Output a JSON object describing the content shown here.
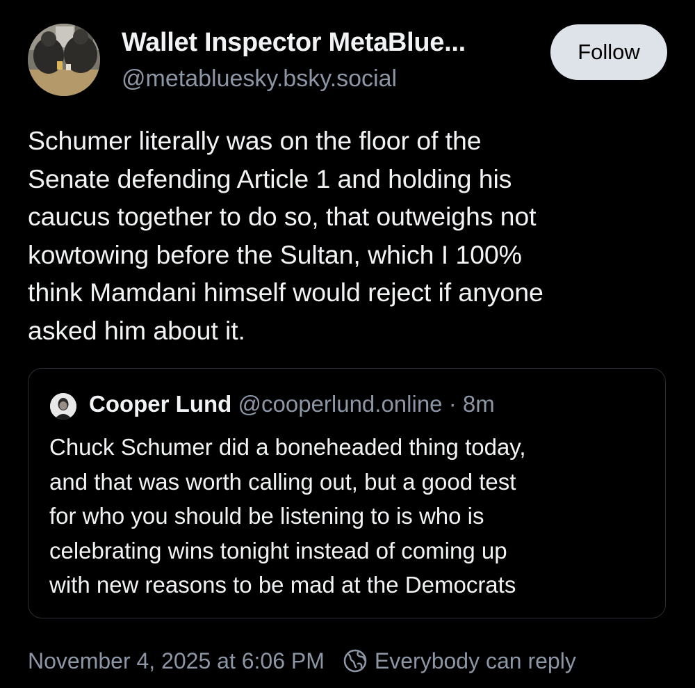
{
  "author": {
    "display_name": "Wallet Inspector MetaBlue...",
    "handle": "@metabluesky.bsky.social"
  },
  "follow_button": {
    "label": "Follow"
  },
  "post": {
    "text": "Schumer literally was on the floor of the\nSenate defending Article 1 and holding his\ncaucus together to do so, that outweighs not\nkowtowing before the Sultan, which I 100%\nthink Mamdani himself would reject if anyone\nasked him about it."
  },
  "quoted_post": {
    "display_name": "Cooper Lund",
    "handle": "@cooperlund.online",
    "separator": "·",
    "time": "8m",
    "text": "Chuck Schumer did a boneheaded thing today,\nand that was worth calling out, but a good test\nfor who you should be listening to is who is\ncelebrating wins tonight instead of coming up\nwith new reasons to be mad at the Democrats"
  },
  "footer": {
    "timestamp": "November 4, 2025 at 6:06 PM",
    "reply_setting_icon": "globe-icon",
    "reply_setting": "Everybody can reply"
  },
  "colors": {
    "background": "#000000",
    "text_primary": "#f1f3f5",
    "text_secondary": "#8c96a5",
    "follow_button_bg": "#dee3ea",
    "quote_border": "#2a2f36"
  }
}
